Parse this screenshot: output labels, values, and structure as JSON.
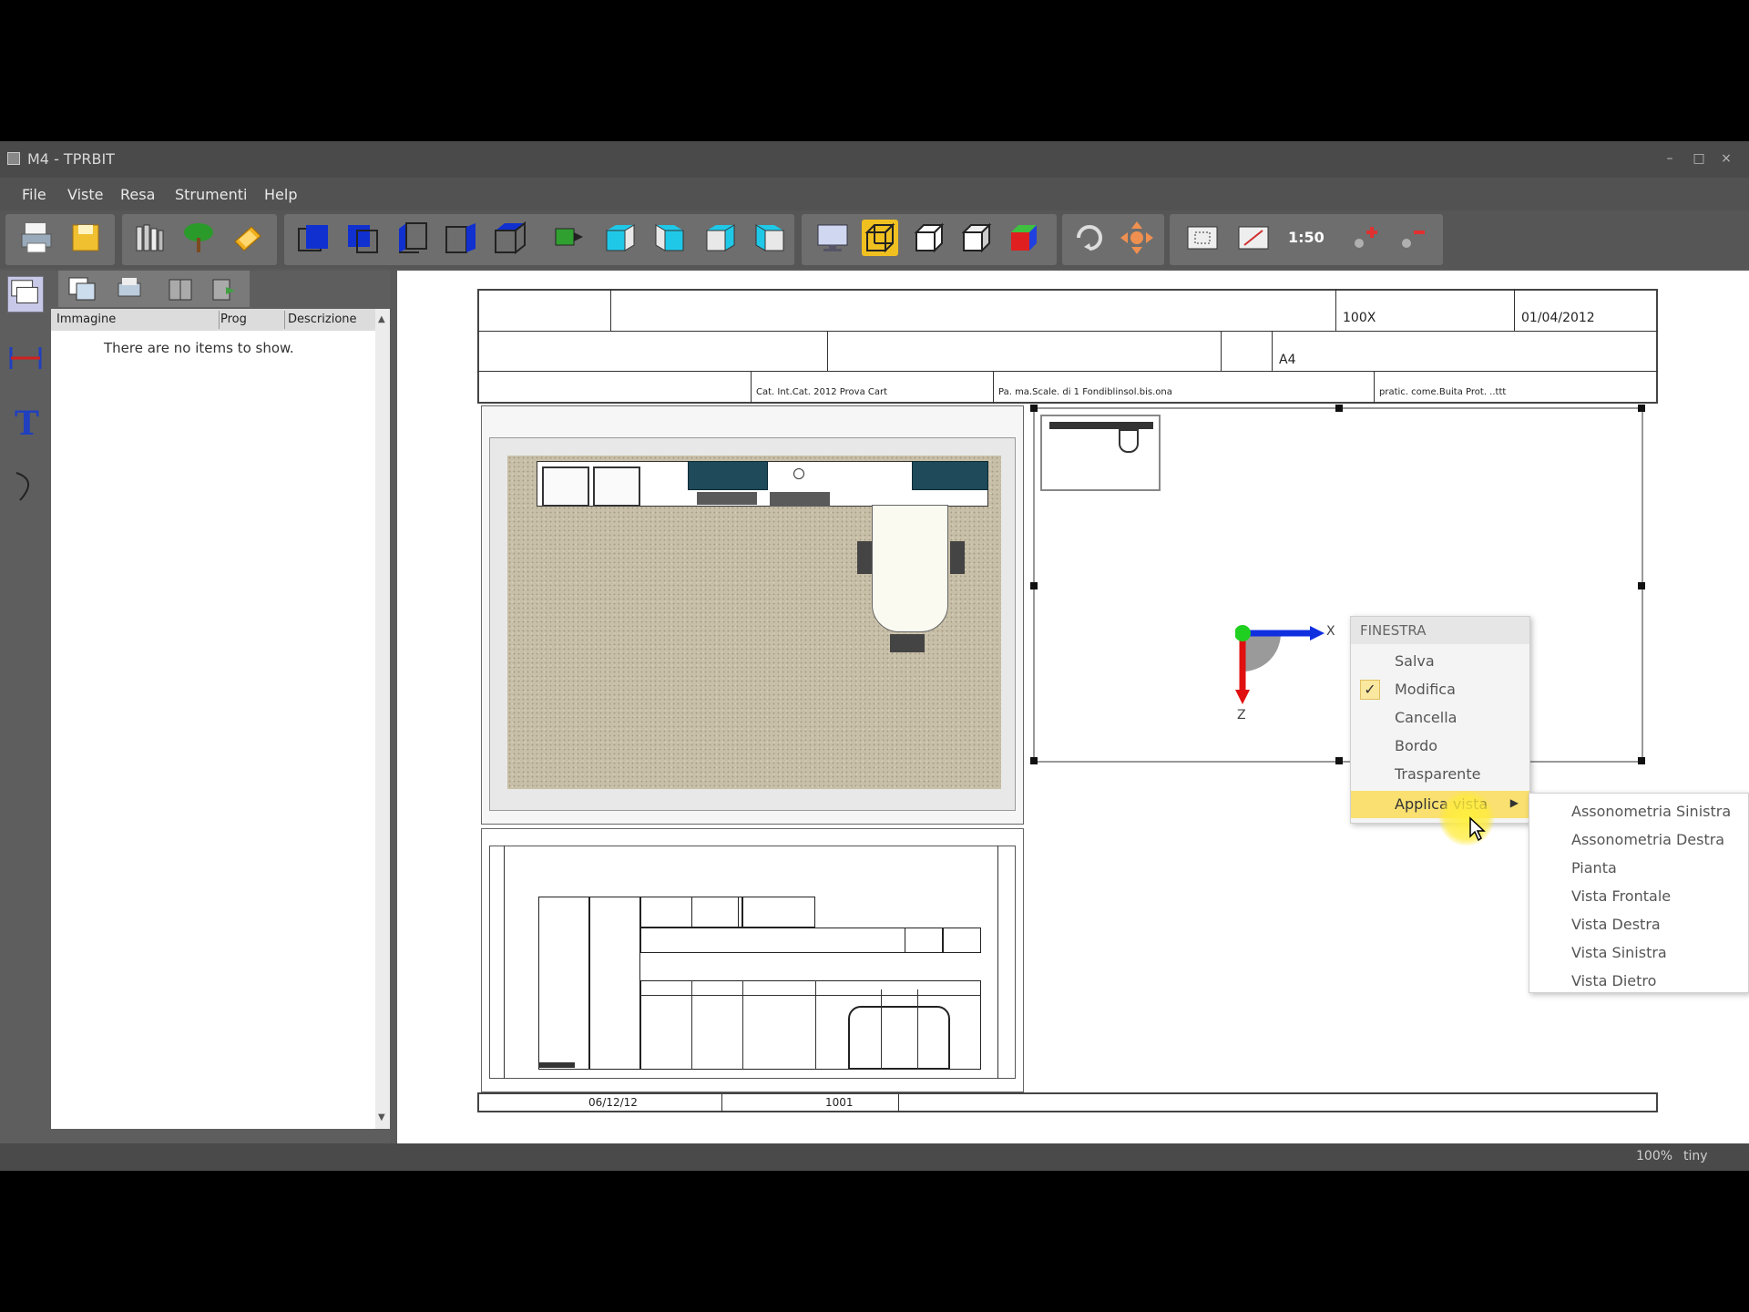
{
  "window": {
    "title": "M4 - TPRBIT"
  },
  "menu": [
    "File",
    "Viste",
    "Resa",
    "Strumenti",
    "Help"
  ],
  "side_panel": {
    "columns": [
      "Immagine",
      "Prog",
      "Descrizione"
    ],
    "empty_message": "There are no items to show."
  },
  "toolbar": {
    "scale_label": "1:50"
  },
  "sheet": {
    "header_val_1": "100X",
    "header_val_2": "01/04/2012",
    "header_val_3": "A4",
    "row3_text_1": "Cat. Int.Cat. 2012 Prova Cart",
    "row3_text_2": "Pa. ma.Scale. di 1 Fondiblinsol.bis.ona",
    "row3_text_3": "pratic. come.Buita Prot. ..ttt",
    "footer_val_1": "06/12/12",
    "footer_val_2": "1001"
  },
  "axis": {
    "x_label": "X",
    "z_label": "Z"
  },
  "context_menu": {
    "header": "FINESTRA",
    "items": [
      "Salva",
      "Modifica",
      "Cancella",
      "Bordo",
      "Trasparente",
      "Applica vista"
    ],
    "checked": "Modifica",
    "highlighted": "Applica vista"
  },
  "submenu": {
    "items": [
      "Assonometria Sinistra",
      "Assonometria Destra",
      "Pianta",
      "Vista Frontale",
      "Vista Destra",
      "Vista Sinistra",
      "Vista Dietro"
    ]
  },
  "status": {
    "left": "100%",
    "right": "tiny"
  }
}
